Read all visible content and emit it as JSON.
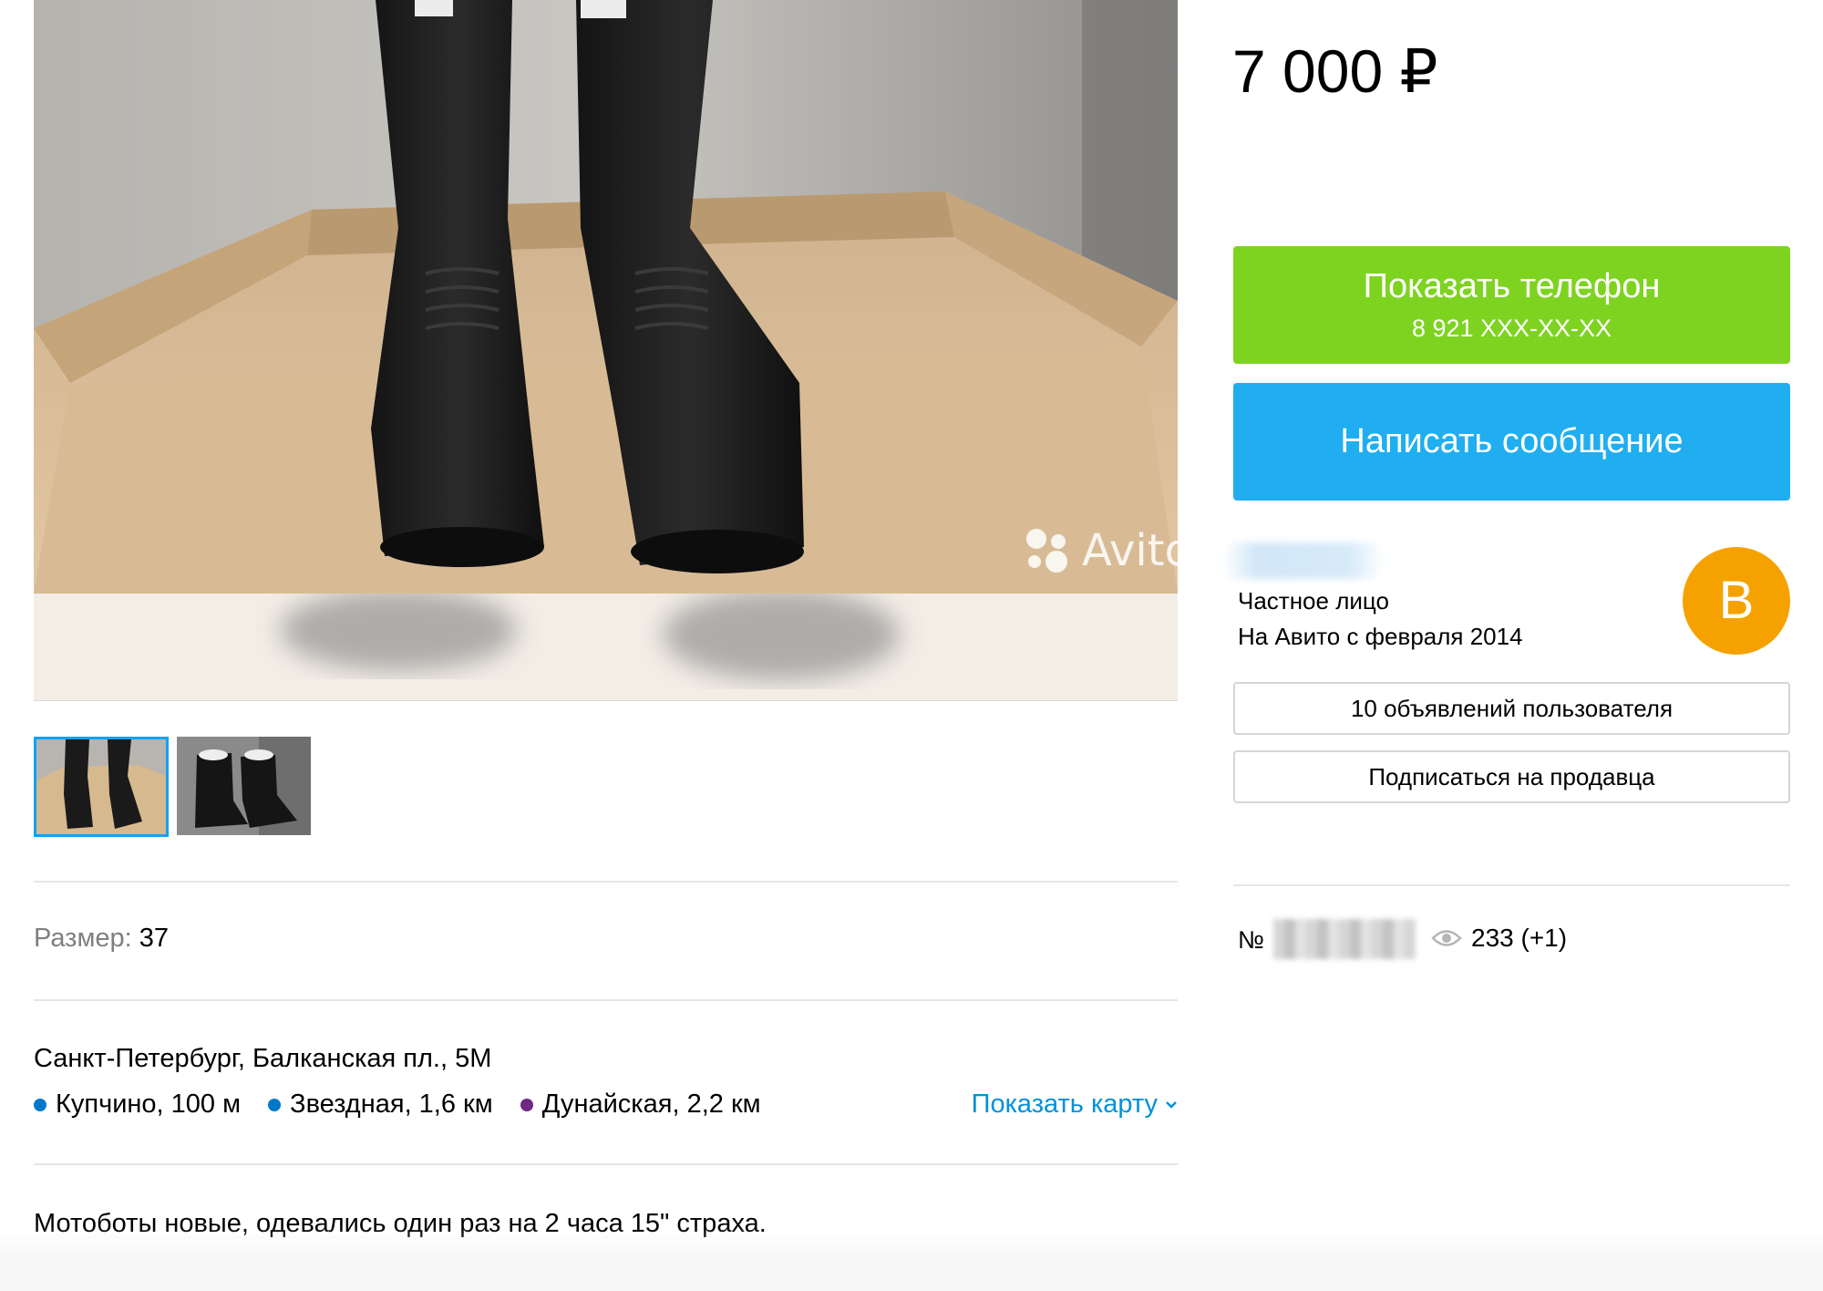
{
  "listing": {
    "watermark": "Avito",
    "params": {
      "size_label": "Размер:",
      "size_value": "37"
    },
    "address": {
      "line": "Санкт-Петербург, Балканская пл., 5М",
      "metro": [
        {
          "name": "Купчино, 100 м",
          "color": "#0078c9"
        },
        {
          "name": "Звездная, 1,6 км",
          "color": "#0078c9"
        },
        {
          "name": "Дунайская, 2,2 км",
          "color": "#702785"
        }
      ],
      "show_map": "Показать карту"
    },
    "description": "Мотоботы новые, одевались один раз на 2 часа 15\" страха."
  },
  "sidebar": {
    "price": "7 000 ₽",
    "phone_button": {
      "label": "Показать телефон",
      "number": "8 921 XXX-XX-XX"
    },
    "message_button": "Написать сообщение",
    "seller": {
      "type": "Частное лицо",
      "since": "На Авито с февраля 2014",
      "avatar_letter": "В"
    },
    "ads_button": "10 объявлений пользователя",
    "subscribe_button": "Подписаться на продавца",
    "ad_number_label": "№",
    "views": "233 (+1)"
  },
  "colors": {
    "phone_button": "#7ed321",
    "message_button": "#20aef0",
    "avatar": "#f5a200",
    "link": "#0091d9"
  }
}
